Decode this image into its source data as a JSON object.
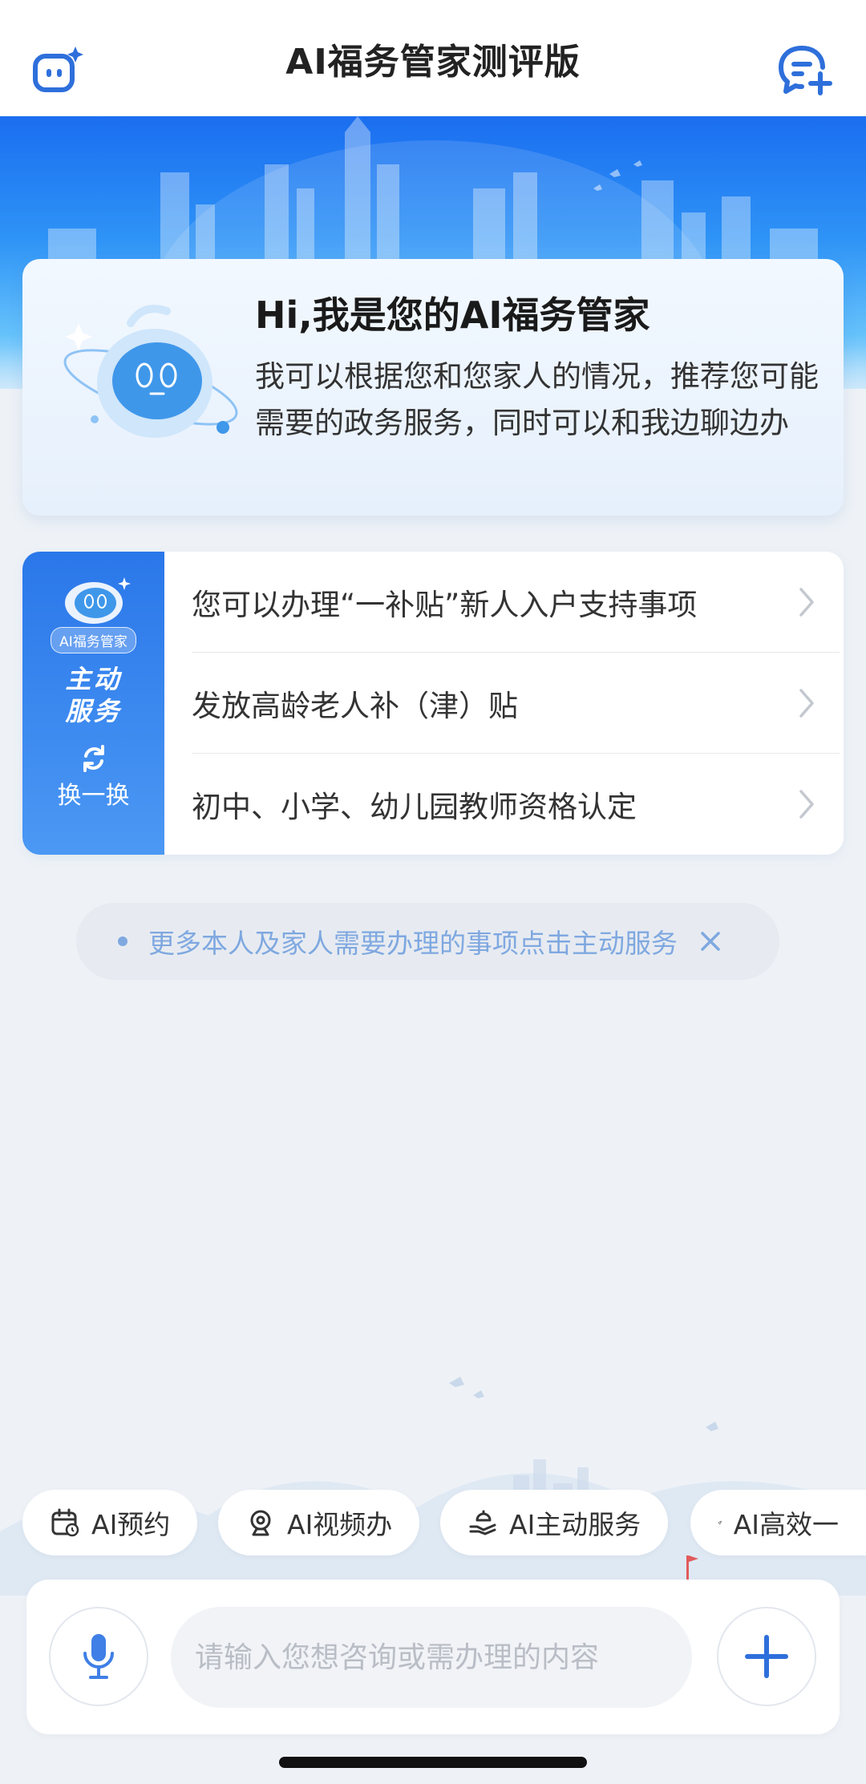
{
  "header": {
    "title": "AI福务管家测评版",
    "left_icon": "robot-face-icon",
    "right_icon": "new-chat-icon"
  },
  "welcome": {
    "title": "Hi,我是您的AI福务管家",
    "description": "我可以根据您和您家人的情况，推荐您可能需要的政务服务，同时可以和我边聊边办"
  },
  "service_panel": {
    "badge": "AI福务管家",
    "title_line1": "主动",
    "title_line2": "服务",
    "refresh_label": "换一换",
    "items": [
      {
        "label": "您可以办理“一补贴”新人入户支持事项"
      },
      {
        "label": "发放高龄老人补（津）贴"
      },
      {
        "label": "初中、小学、幼儿园教师资格认定"
      }
    ]
  },
  "tip": {
    "text": "更多本人及家人需要办理的事项点击主动服务"
  },
  "quick_actions": [
    {
      "label": "AI预约",
      "icon": "calendar-icon"
    },
    {
      "label": "AI视频办",
      "icon": "webcam-icon"
    },
    {
      "label": "AI主动服务",
      "icon": "hand-service-icon"
    },
    {
      "label": "AI高效一",
      "icon": "rocket-icon"
    }
  ],
  "input": {
    "placeholder": "请输入您想咨询或需办理的内容",
    "value": ""
  },
  "colors": {
    "accent": "#2a77ea",
    "background": "#eef2f7",
    "tip_text": "#7fa8e0"
  }
}
